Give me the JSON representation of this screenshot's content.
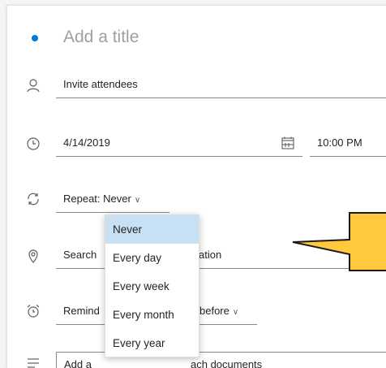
{
  "event": {
    "title_placeholder": "Add a title",
    "attendees_placeholder": "Invite attendees",
    "date": "4/14/2019",
    "time": "10:00 PM",
    "repeat_label": "Repeat: Never",
    "location_placeholder_left": "Search",
    "location_placeholder_right": "ation",
    "reminder_left": "Remind",
    "reminder_right": "before",
    "body_placeholder_left": "Add a",
    "body_placeholder_right": "ach documents"
  },
  "repeat_dropdown": {
    "selected": "Never",
    "options": [
      "Never",
      "Every day",
      "Every week",
      "Every month",
      "Every year"
    ]
  },
  "colors": {
    "accent": "#0078d4",
    "selected_option_bg": "#c7e0f4",
    "callout_fill": "#ffc83d"
  },
  "icons": [
    "person-icon",
    "clock-icon",
    "repeat-icon",
    "location-pin-icon",
    "alarm-icon",
    "notes-icon",
    "calendar-icon"
  ]
}
